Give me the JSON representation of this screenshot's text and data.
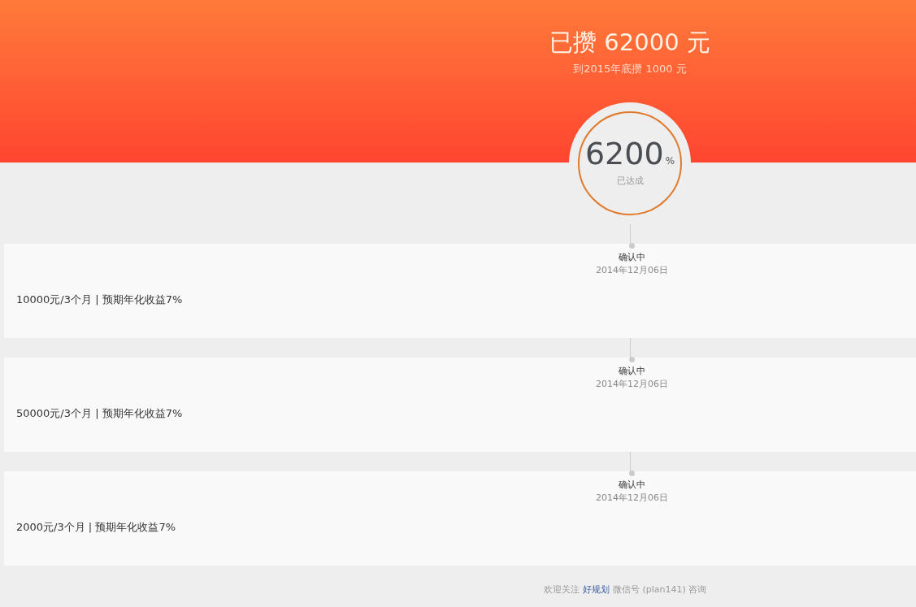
{
  "header": {
    "title": "已攒 62000 元",
    "subtitle": "到2015年底攒 1000 元"
  },
  "progress": {
    "value": "6200",
    "unit": "%",
    "label": "已达成"
  },
  "items": [
    {
      "status": "确认中",
      "date": "2014年12月06日",
      "description": "10000元/3个月 | 预期年化收益7%"
    },
    {
      "status": "确认中",
      "date": "2014年12月06日",
      "description": "50000元/3个月 | 预期年化收益7%"
    },
    {
      "status": "确认中",
      "date": "2014年12月06日",
      "description": "2000元/3个月 | 预期年化收益7%"
    }
  ],
  "footer": {
    "text_before": "欢迎关注",
    "link": "好规划",
    "text_after": "微信号 (plan141) 咨询"
  }
}
